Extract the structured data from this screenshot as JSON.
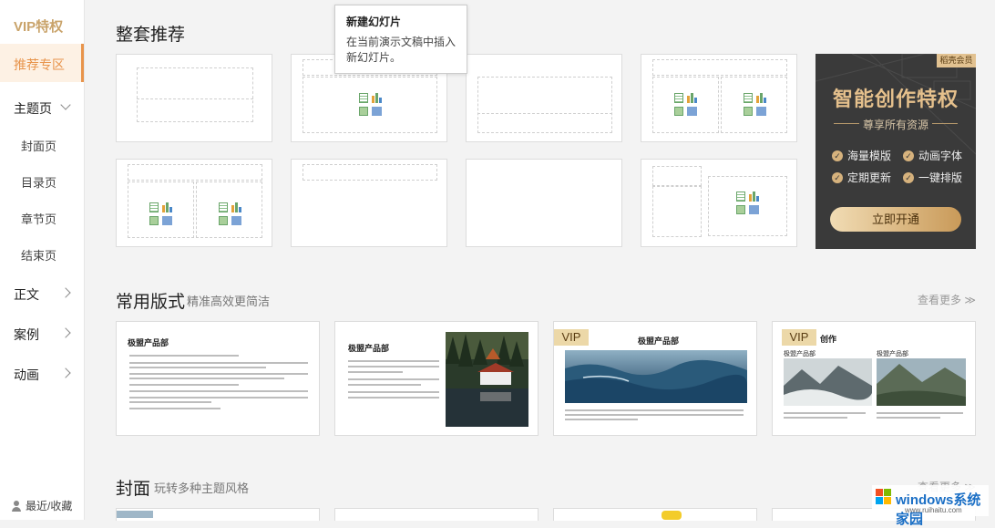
{
  "sidebar": {
    "vip": "VIP特权",
    "active": "推荐专区",
    "theme": "主题页",
    "subs": [
      "封面页",
      "目录页",
      "章节页",
      "结束页"
    ],
    "main": "正文",
    "cases": "案例",
    "anim": "动画",
    "recent": "最近/收藏"
  },
  "section1": {
    "title": "整套推荐"
  },
  "section2": {
    "title": "常用版式",
    "subtitle": "精准高效更简洁",
    "more": "查看更多"
  },
  "section3": {
    "title": "封面",
    "subtitle": "玩转多种主题风格",
    "more": "查看更多"
  },
  "tooltip": {
    "title": "新建幻灯片",
    "body": "在当前演示文稿中插入新幻灯片。"
  },
  "vip_card": {
    "tag": "稻壳会员",
    "title": "智能创作特权",
    "subtitle": "尊享所有资源",
    "features": [
      "海量模版",
      "动画字体",
      "定期更新",
      "一键排版"
    ],
    "button": "立即开通"
  },
  "layouts": [
    {
      "title": "极盟产品部"
    },
    {
      "title": "极盟产品部"
    },
    {
      "badge": "VIP",
      "title": "极盟产品部"
    },
    {
      "badge": "VIP",
      "title": "创作",
      "col1": "极盟产品部",
      "col2": "极盟产品部"
    }
  ],
  "watermark": {
    "brand": "windows系统家园",
    "url": "www.ruihaitu.com"
  }
}
